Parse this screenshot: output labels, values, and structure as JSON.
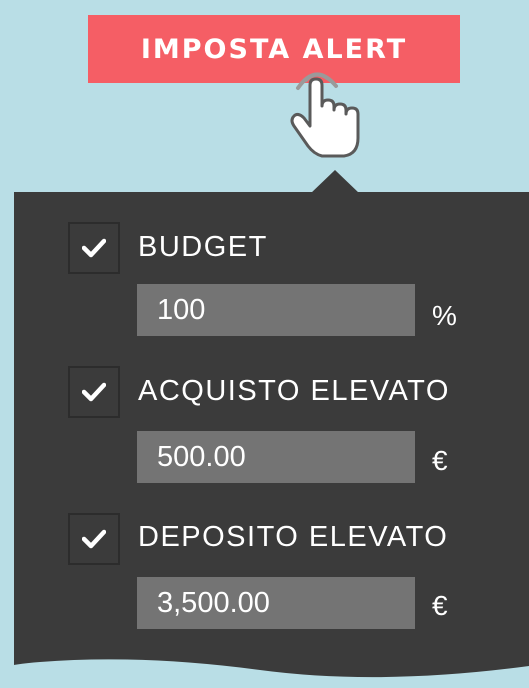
{
  "cta": {
    "label": "IMPOSTA ALERT"
  },
  "alerts": [
    {
      "label": "BUDGET",
      "checked": true,
      "value": "100",
      "unit": "%"
    },
    {
      "label": "ACQUISTO ELEVATO",
      "checked": true,
      "value": "500.00",
      "unit": "€"
    },
    {
      "label": "DEPOSITO ELEVATO",
      "checked": true,
      "value": "3,500.00",
      "unit": "€"
    }
  ],
  "colors": {
    "background": "#b9dee6",
    "button": "#f55e65",
    "panel": "#3b3b3b",
    "field": "#747474",
    "text": "#ffffff"
  },
  "icons": [
    "pointer-hand-icon",
    "checkmark-icon"
  ]
}
